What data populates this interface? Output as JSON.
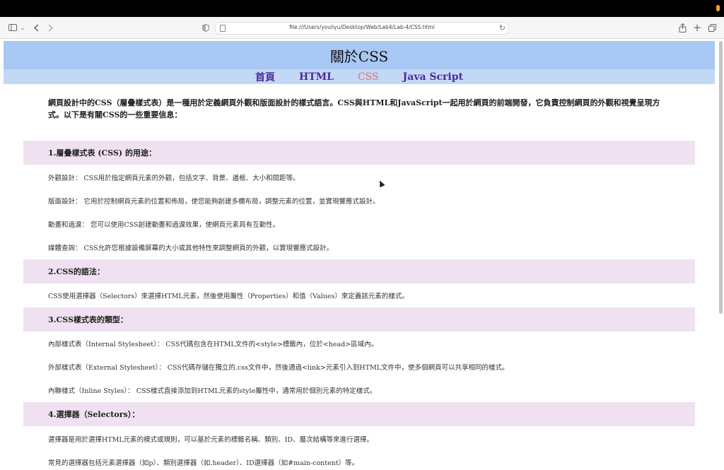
{
  "browser": {
    "url": "file:///Users/youliyu/Desktop/Web/Lab4/Lab-4/CSS.html"
  },
  "page": {
    "title": "關於CSS",
    "nav": [
      {
        "label": "首頁",
        "active": false
      },
      {
        "label": "HTML",
        "active": false
      },
      {
        "label": "CSS",
        "active": true
      },
      {
        "label": "Java Script",
        "active": false
      }
    ],
    "intro": "網頁設計中的CSS（層疊樣式表）是一種用於定義網頁外觀和版面設計的樣式語言。CSS與HTML和JavaScript一起用於網頁的前端開發，它負責控制網頁的外觀和視覺呈現方式。以下是有關CSS的一些重要信息：",
    "sections": [
      {
        "heading": "1.層疊樣式表 (CSS) 的用途：",
        "items": [
          "外觀設計： CSS用於指定網頁元素的外觀，包括文字、背景、邊框、大小和間距等。",
          "版面設計： 它用於控制網頁元素的位置和佈局，使您能夠創建多欄布局，調整元素的位置，並實現響應式設計。",
          "動畫和過渡： 您可以使用CSS創建動畫和過渡效果，使網頁元素具有互動性。",
          "媒體查詢： CSS允許您根據設備屏幕的大小或其他特性來調整網頁的外觀，以實現響應式設計。"
        ]
      },
      {
        "heading": "2.CSS的語法：",
        "items": [
          "CSS使用選擇器（Selectors）來選擇HTML元素，然後使用屬性（Properties）和值（Values）來定義該元素的樣式。"
        ]
      },
      {
        "heading": "3.CSS樣式表的類型：",
        "items": [
          "內部樣式表（Internal Stylesheet）： CSS代碼包含在HTML文件的<style>標籤內，位於<head>區域內。",
          "外部樣式表（External Stylesheet）： CSS代碼存儲在獨立的.css文件中，然後通過<link>元素引入到HTML文件中，使多個網頁可以共享相同的樣式。",
          "內聯樣式（Inline Styles）： CSS樣式直接添加到HTML元素的style屬性中，通常用於個別元素的特定樣式。"
        ]
      },
      {
        "heading": "4.選擇器（Selectors）：",
        "items": [
          "選擇器是用於選擇HTML元素的模式或規則，可以基於元素的標籤名稱、類別、ID、層次結構等來進行選擇。",
          "常見的選擇器包括元素選擇器（如p）、類別選擇器（如.header）、ID選擇器（如#main-content）等。"
        ]
      }
    ]
  },
  "colors": {
    "header_bg": "#a8c7f2",
    "nav_bg": "#c3d8f5",
    "nav_link": "#4b2c9e",
    "nav_active": "#e0707a",
    "section_bg": "#efe1f0"
  }
}
